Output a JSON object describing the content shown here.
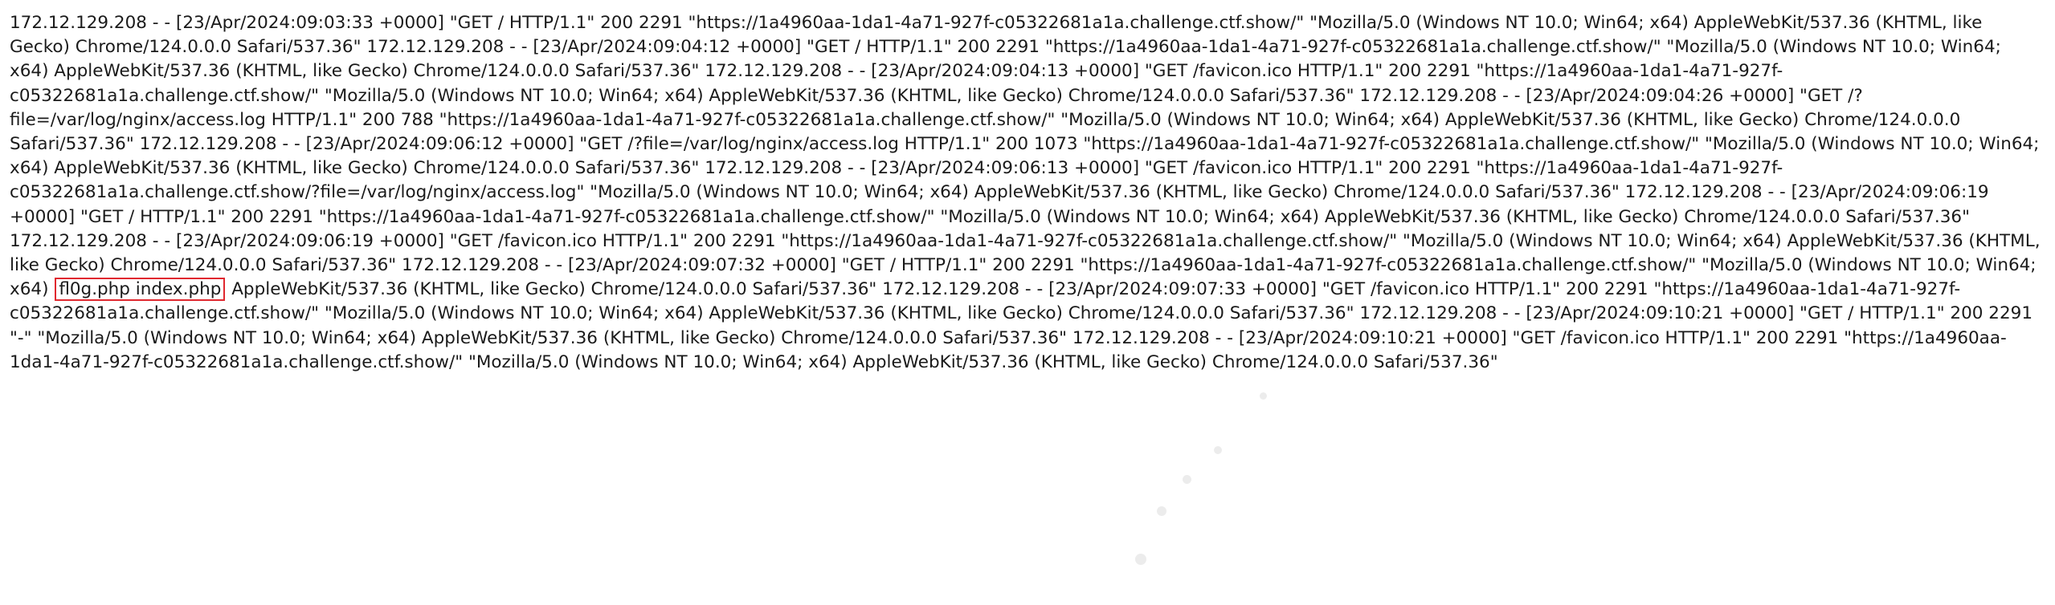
{
  "log": {
    "before_highlight": "172.12.129.208 - - [23/Apr/2024:09:03:33 +0000] \"GET / HTTP/1.1\" 200 2291 \"https://1a4960aa-1da1-4a71-927f-c05322681a1a.challenge.ctf.show/\" \"Mozilla/5.0 (Windows NT 10.0; Win64; x64) AppleWebKit/537.36 (KHTML, like Gecko) Chrome/124.0.0.0 Safari/537.36\" 172.12.129.208 - - [23/Apr/2024:09:04:12 +0000] \"GET / HTTP/1.1\" 200 2291 \"https://1a4960aa-1da1-4a71-927f-c05322681a1a.challenge.ctf.show/\" \"Mozilla/5.0 (Windows NT 10.0; Win64; x64) AppleWebKit/537.36 (KHTML, like Gecko) Chrome/124.0.0.0 Safari/537.36\" 172.12.129.208 - - [23/Apr/2024:09:04:13 +0000] \"GET /favicon.ico HTTP/1.1\" 200 2291 \"https://1a4960aa-1da1-4a71-927f-c05322681a1a.challenge.ctf.show/\" \"Mozilla/5.0 (Windows NT 10.0; Win64; x64) AppleWebKit/537.36 (KHTML, like Gecko) Chrome/124.0.0.0 Safari/537.36\" 172.12.129.208 - - [23/Apr/2024:09:04:26 +0000] \"GET /?file=/var/log/nginx/access.log HTTP/1.1\" 200 788 \"https://1a4960aa-1da1-4a71-927f-c05322681a1a.challenge.ctf.show/\" \"Mozilla/5.0 (Windows NT 10.0; Win64; x64) AppleWebKit/537.36 (KHTML, like Gecko) Chrome/124.0.0.0 Safari/537.36\" 172.12.129.208 - - [23/Apr/2024:09:06:12 +0000] \"GET /?file=/var/log/nginx/access.log HTTP/1.1\" 200 1073 \"https://1a4960aa-1da1-4a71-927f-c05322681a1a.challenge.ctf.show/\" \"Mozilla/5.0 (Windows NT 10.0; Win64; x64) AppleWebKit/537.36 (KHTML, like Gecko) Chrome/124.0.0.0 Safari/537.36\" 172.12.129.208 - - [23/Apr/2024:09:06:13 +0000] \"GET /favicon.ico HTTP/1.1\" 200 2291 \"https://1a4960aa-1da1-4a71-927f-c05322681a1a.challenge.ctf.show/?file=/var/log/nginx/access.log\" \"Mozilla/5.0 (Windows NT 10.0; Win64; x64) AppleWebKit/537.36 (KHTML, like Gecko) Chrome/124.0.0.0 Safari/537.36\" 172.12.129.208 - - [23/Apr/2024:09:06:19 +0000] \"GET / HTTP/1.1\" 200 2291 \"https://1a4960aa-1da1-4a71-927f-c05322681a1a.challenge.ctf.show/\" \"Mozilla/5.0 (Windows NT 10.0; Win64; x64) AppleWebKit/537.36 (KHTML, like Gecko) Chrome/124.0.0.0 Safari/537.36\" 172.12.129.208 - - [23/Apr/2024:09:06:19 +0000] \"GET /favicon.ico HTTP/1.1\" 200 2291 \"https://1a4960aa-1da1-4a71-927f-c05322681a1a.challenge.ctf.show/\" \"Mozilla/5.0 (Windows NT 10.0; Win64; x64) AppleWebKit/537.36 (KHTML, like Gecko) Chrome/124.0.0.0 Safari/537.36\" 172.12.129.208 - - [23/Apr/2024:09:07:32 +0000] \"GET / HTTP/1.1\" 200 2291 \"https://1a4960aa-1da1-4a71-927f-c05322681a1a.challenge.ctf.show/\" \"Mozilla/5.0 (Windows NT 10.0; Win64; x64)",
    "highlighted": "fl0g.php index.php",
    "after_highlight": "AppleWebKit/537.36 (KHTML, like Gecko) Chrome/124.0.0.0 Safari/537.36\" 172.12.129.208 - - [23/Apr/2024:09:07:33 +0000] \"GET /favicon.ico HTTP/1.1\" 200 2291 \"https://1a4960aa-1da1-4a71-927f-c05322681a1a.challenge.ctf.show/\" \"Mozilla/5.0 (Windows NT 10.0; Win64; x64) AppleWebKit/537.36 (KHTML, like Gecko) Chrome/124.0.0.0 Safari/537.36\" 172.12.129.208 - - [23/Apr/2024:09:10:21 +0000] \"GET / HTTP/1.1\" 200 2291 \"-\" \"Mozilla/5.0 (Windows NT 10.0; Win64; x64) AppleWebKit/537.36 (KHTML, like Gecko) Chrome/124.0.0.0 Safari/537.36\" 172.12.129.208 - - [23/Apr/2024:09:10:21 +0000] \"GET /favicon.ico HTTP/1.1\" 200 2291 \"https://1a4960aa-1da1-4a71-927f-c05322681a1a.challenge.ctf.show/\" \"Mozilla/5.0 (Windows NT 10.0; Win64; x64) AppleWebKit/537.36 (KHTML, like Gecko) Chrome/124.0.0.0 Safari/537.36\""
  },
  "colors": {
    "background": "#ffffff",
    "text": "#1a1a1a",
    "highlight_border": "#e0282f"
  }
}
